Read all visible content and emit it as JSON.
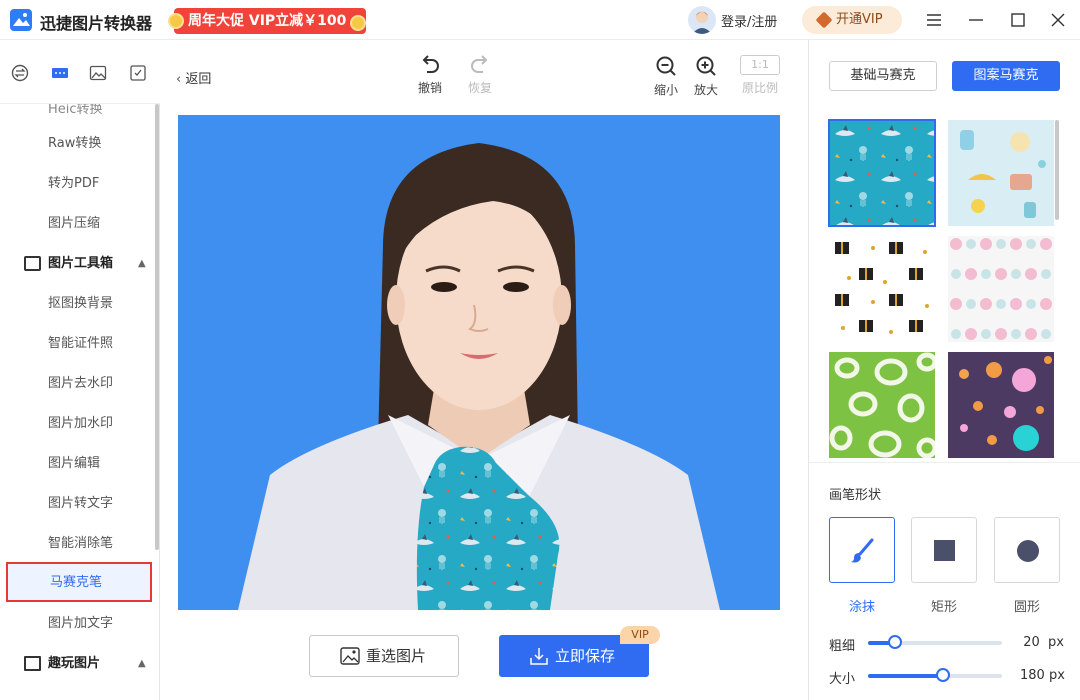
{
  "titlebar": {
    "app_title": "迅捷图片转换器",
    "promo": "周年大促 VIP立减￥100",
    "login": "登录/注册",
    "vip": "开通VIP"
  },
  "nav": {
    "partial_item": "Heic转换",
    "items": [
      "Raw转换",
      "转为PDF",
      "图片压缩"
    ],
    "toolbox_title": "图片工具箱",
    "toolbox_items": [
      "抠图换背景",
      "智能证件照",
      "图片去水印",
      "图片加水印",
      "图片编辑",
      "图片转文字",
      "智能消除笔",
      "马赛克笔",
      "图片加文字"
    ],
    "fun_title": "趣玩图片"
  },
  "toolbar": {
    "back": "返回",
    "undo": "撤销",
    "redo": "恢复",
    "zoom_out": "缩小",
    "zoom_in": "放大",
    "ratio_box": "1:1",
    "original": "原比例"
  },
  "actions": {
    "reselect": "重选图片",
    "save": "立即保存",
    "vip_tag": "VIP"
  },
  "panel": {
    "tab_basic": "基础马赛克",
    "tab_pattern": "图案马赛克",
    "brush_title": "画笔形状",
    "brushes": [
      "涂抹",
      "矩形",
      "圆形"
    ],
    "thickness_label": "粗细",
    "thickness_value": "20",
    "thickness_unit": "px",
    "thickness_fraction": 0.2,
    "size_label": "大小",
    "size_value": "180",
    "size_unit": "px",
    "size_fraction": 0.56
  },
  "colors": {
    "accent": "#2f6cf2",
    "canvas_bg": "#3f8ff1",
    "promo": "#f2433a",
    "highlight_border": "#e53935"
  }
}
